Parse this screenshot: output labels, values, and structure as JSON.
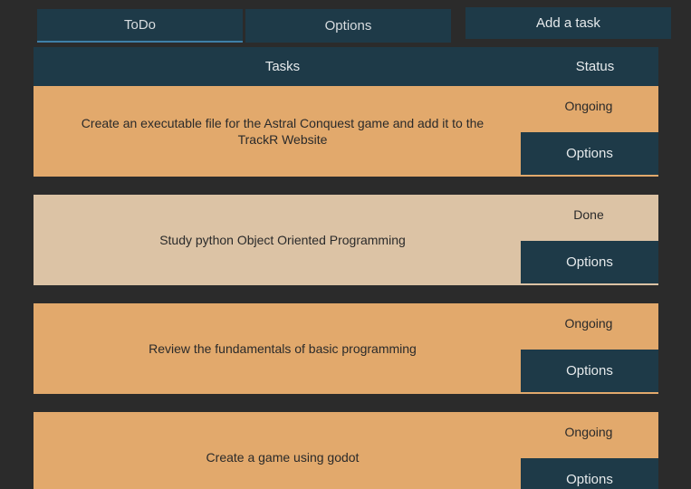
{
  "tabs": [
    {
      "label": "ToDo"
    },
    {
      "label": "Options"
    }
  ],
  "add_task_label": "Add a task",
  "table": {
    "header_tasks": "Tasks",
    "header_status": "Status",
    "rows": [
      {
        "task": "Create an executable file for the Astral Conquest game and add it to the TrackR Website",
        "status": "Ongoing",
        "button": "Options"
      },
      {
        "task": "Study python Object Oriented Programming",
        "status": "Done",
        "button": "Options"
      },
      {
        "task": "Review the fundamentals of basic programming",
        "status": "Ongoing",
        "button": "Options"
      },
      {
        "task": "Create a game using godot",
        "status": "Ongoing",
        "button": "Options"
      }
    ]
  },
  "colors": {
    "background": "#2b2b2b",
    "panel_dark": "#1e3a48",
    "row_ongoing": "#e2a96c",
    "row_done": "#dcc3a5"
  }
}
